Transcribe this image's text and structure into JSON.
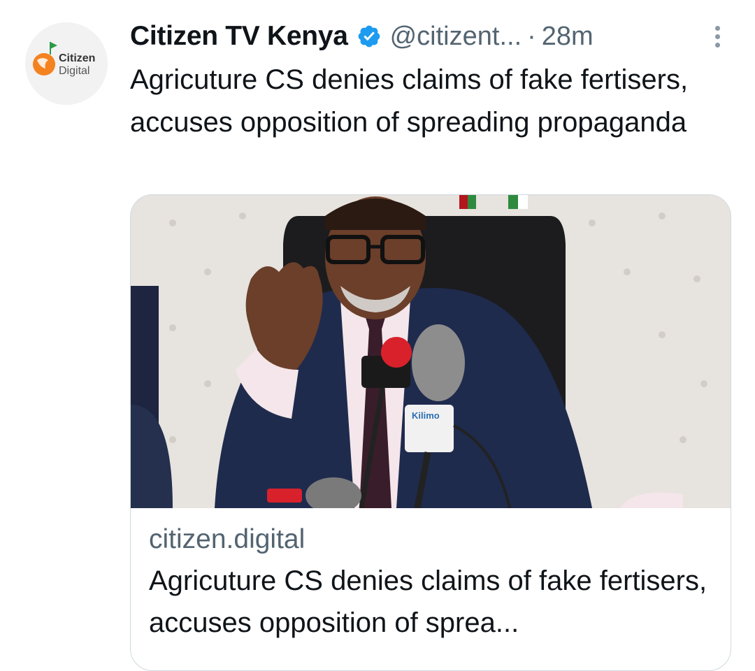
{
  "avatar": {
    "line1": "Citizen",
    "line2": "Digital"
  },
  "header": {
    "name": "Citizen TV Kenya",
    "handle": "@citizent...",
    "dot": "·",
    "time": "28m"
  },
  "tweet": {
    "text": "Agricuture CS denies claims of fake fertisers, accuses opposition of spreading propaganda"
  },
  "card": {
    "image_mic_labels": [
      "Kilimo"
    ],
    "domain": "citizen.digital",
    "title": "Agricuture CS denies claims of fake fertisers, accuses opposition of sprea..."
  },
  "colors": {
    "verified": "#1d9bf0",
    "secondary_text": "#536471",
    "brand_orange": "#f58220",
    "brand_green": "#2e9a47"
  },
  "icons": [
    "verified-badge-icon",
    "more-options-icon"
  ]
}
